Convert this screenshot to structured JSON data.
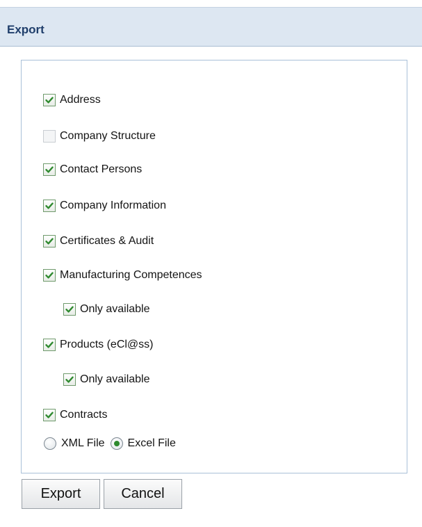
{
  "header": {
    "title": "Export"
  },
  "options": [
    {
      "label": "Address",
      "checked": true
    },
    {
      "label": "Company Structure",
      "checked": false
    },
    {
      "label": "Contact Persons",
      "checked": true
    },
    {
      "label": "Company Information",
      "checked": true
    },
    {
      "label": "Certificates & Audit",
      "checked": true
    },
    {
      "label": "Manufacturing Competences",
      "checked": true
    },
    {
      "label": "Only available",
      "checked": true
    },
    {
      "label": "Products (eCl@ss)",
      "checked": true
    },
    {
      "label": "Only available",
      "checked": true
    },
    {
      "label": "Contracts",
      "checked": true
    }
  ],
  "format": {
    "options": [
      "XML File",
      "Excel File"
    ],
    "selected": "Excel File"
  },
  "buttons": {
    "export": "Export",
    "cancel": "Cancel"
  },
  "colors": {
    "header_bg": "#dde7f2",
    "header_text": "#1f3e6b",
    "check": "#2f8a2f"
  },
  "icons": {
    "checked": "checkmark-icon",
    "radio_selected": "radio-dot-icon"
  }
}
